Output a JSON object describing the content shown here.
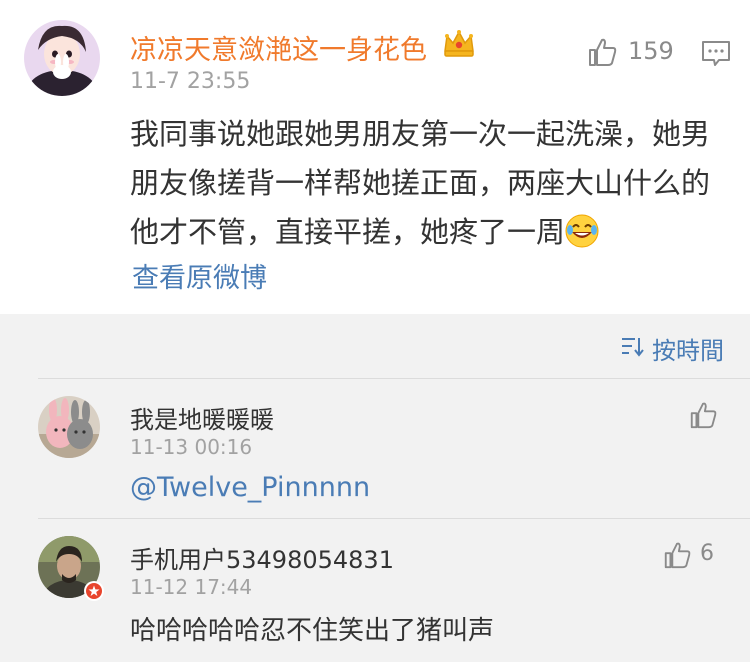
{
  "post": {
    "author": "凉凉天意潋滟这一身花色",
    "timestamp": "11-7 23:55",
    "likes": "159",
    "body": "我同事说她跟她男朋友第一次一起洗澡，她男朋友像搓背一样帮她搓正面，两座大山什么的他才不管，直接平搓，她疼了一周",
    "view_original": "查看原微博"
  },
  "sort": {
    "label": "按時間"
  },
  "comments": [
    {
      "name": "我是地暖暖暖",
      "time": "11-13 00:16",
      "likes": "",
      "mention": "@Twelve_Pinnnnn"
    },
    {
      "name": "手机用户53498054831",
      "time": "11-12 17:44",
      "likes": "6",
      "text": "哈哈哈哈哈忍不住笑出了猪叫声"
    }
  ],
  "colors": {
    "author": "#f07a2c",
    "link": "#4a7cb5",
    "meta": "#a2a2a2"
  },
  "icons": [
    "crown-icon",
    "thumbs-up-icon",
    "comment-icon",
    "laughing-emoji-icon",
    "sort-icon",
    "verified-badge-icon"
  ]
}
